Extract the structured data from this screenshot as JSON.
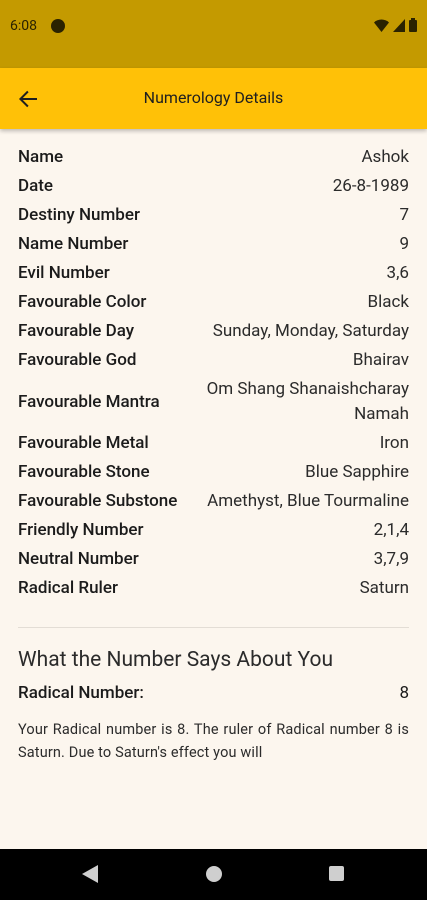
{
  "status_bar": {
    "time": "6:08"
  },
  "app_bar": {
    "title": "Numerology Details"
  },
  "details": [
    {
      "label": "Name",
      "value": "Ashok"
    },
    {
      "label": "Date",
      "value": "26-8-1989"
    },
    {
      "label": "Destiny Number",
      "value": "7"
    },
    {
      "label": "Name Number",
      "value": "9"
    },
    {
      "label": "Evil Number",
      "value": "3,6"
    },
    {
      "label": "Favourable Color",
      "value": "Black"
    },
    {
      "label": "Favourable Day",
      "value": "Sunday, Monday, Saturday"
    },
    {
      "label": "Favourable God",
      "value": "Bhairav"
    },
    {
      "label": "Favourable Mantra",
      "value": "Om Shang Shanaishcharay Namah"
    },
    {
      "label": "Favourable Metal",
      "value": "Iron"
    },
    {
      "label": "Favourable Stone",
      "value": "Blue Sapphire"
    },
    {
      "label": "Favourable Substone",
      "value": "Amethyst, Blue Tourmaline"
    },
    {
      "label": "Friendly Number",
      "value": "2,1,4"
    },
    {
      "label": "Neutral Number",
      "value": "3,7,9"
    },
    {
      "label": "Radical Ruler",
      "value": "Saturn"
    }
  ],
  "about": {
    "title": "What the Number Says About You",
    "radical_label": "Radical Number:",
    "radical_value": "8",
    "description": "Your Radical number is 8. The ruler of Radical number 8 is Saturn. Due to Saturn's effect you will"
  }
}
